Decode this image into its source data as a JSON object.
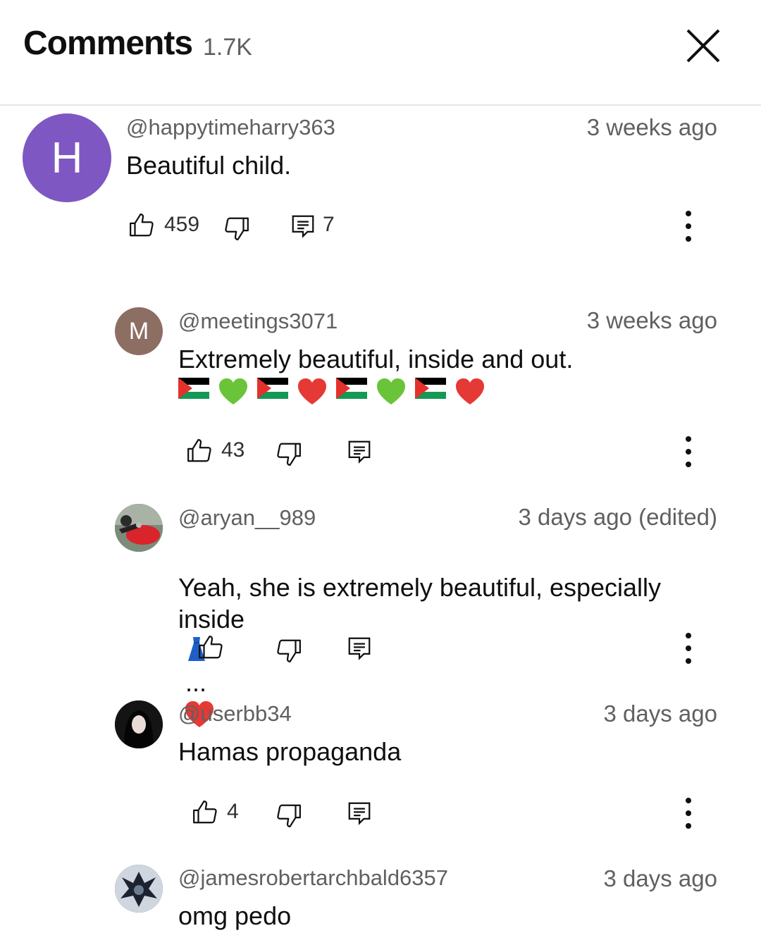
{
  "header": {
    "title": "Comments",
    "count": "1.7K",
    "close_icon": "close-icon"
  },
  "comments": [
    {
      "avatar_letter": "H",
      "avatar_color": "#7e57c2",
      "handle": "@happytimeharry363",
      "time": "3 weeks ago",
      "text": "Beautiful child.",
      "likes": "459",
      "replies": "7"
    },
    {
      "avatar_letter": "M",
      "avatar_color": "#8d6e63",
      "handle": "@meetings3071",
      "time": "3 weeks ago",
      "text": "Extremely beautiful, inside and out.",
      "emojis": [
        "palestine-flag",
        "green-heart",
        "palestine-flag",
        "red-heart",
        "palestine-flag",
        "green-heart",
        "palestine-flag",
        "red-heart"
      ],
      "likes": "43"
    },
    {
      "handle": "@aryan__989",
      "time": "3 days ago (edited)",
      "text": "Yeah, she is extremely beautiful, especially\ninside",
      "text_tail": "...",
      "likes": ""
    },
    {
      "handle": "@userbb34",
      "time": "3 days ago",
      "text": "Hamas propaganda",
      "likes": "4"
    },
    {
      "handle": "@jamesrobertarchbald6357",
      "time": "3 days ago",
      "text": "omg pedo"
    }
  ],
  "colors": {
    "secondary_text": "#606060",
    "divider": "#e5e5e5"
  }
}
